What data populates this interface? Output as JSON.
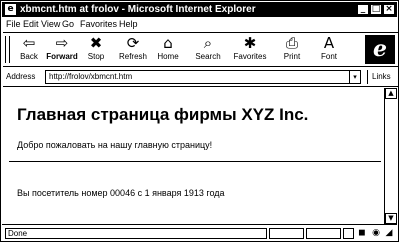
{
  "window": {
    "title": "xbmcnt.htm at frolov - Microsoft Internet Explorer",
    "title_icon": "page-icon",
    "controls": {
      "minimize": "_",
      "maximize": "□",
      "close": "×"
    }
  },
  "menu": {
    "items": [
      "File",
      "Edit",
      "View",
      "Go",
      "Favorites",
      "Help"
    ]
  },
  "toolbar": {
    "buttons": [
      {
        "label": "Back",
        "icon": "back-arrow-icon",
        "glyph": "⇦"
      },
      {
        "label": "Forward",
        "icon": "forward-arrow-icon",
        "glyph": "⇨"
      },
      {
        "label": "Stop",
        "icon": "stop-icon",
        "glyph": "✖"
      },
      {
        "label": "Refresh",
        "icon": "refresh-icon",
        "glyph": "⟳"
      },
      {
        "label": "Home",
        "icon": "home-icon",
        "glyph": "⌂"
      },
      {
        "label": "Search",
        "icon": "search-icon",
        "glyph": "⌕"
      },
      {
        "label": "Favorites",
        "icon": "favorites-icon",
        "glyph": "✱"
      },
      {
        "label": "Print",
        "icon": "print-icon",
        "glyph": "⎙"
      },
      {
        "label": "Font",
        "icon": "font-icon",
        "glyph": "A"
      }
    ],
    "logo": "e"
  },
  "address": {
    "label": "Address",
    "value": "http://frolov/xbmcnt.htm",
    "dropdown": "▾",
    "links": "Links"
  },
  "content": {
    "heading": "Главная страница фирмы XYZ Inc.",
    "welcome": "Добро пожаловать на нашу главную страницу!",
    "visitor": "Вы посетитель номер 00046 с 1 января 1913 года"
  },
  "scroll": {
    "up": "▲",
    "down": "▼"
  },
  "status": {
    "text": "Done"
  }
}
